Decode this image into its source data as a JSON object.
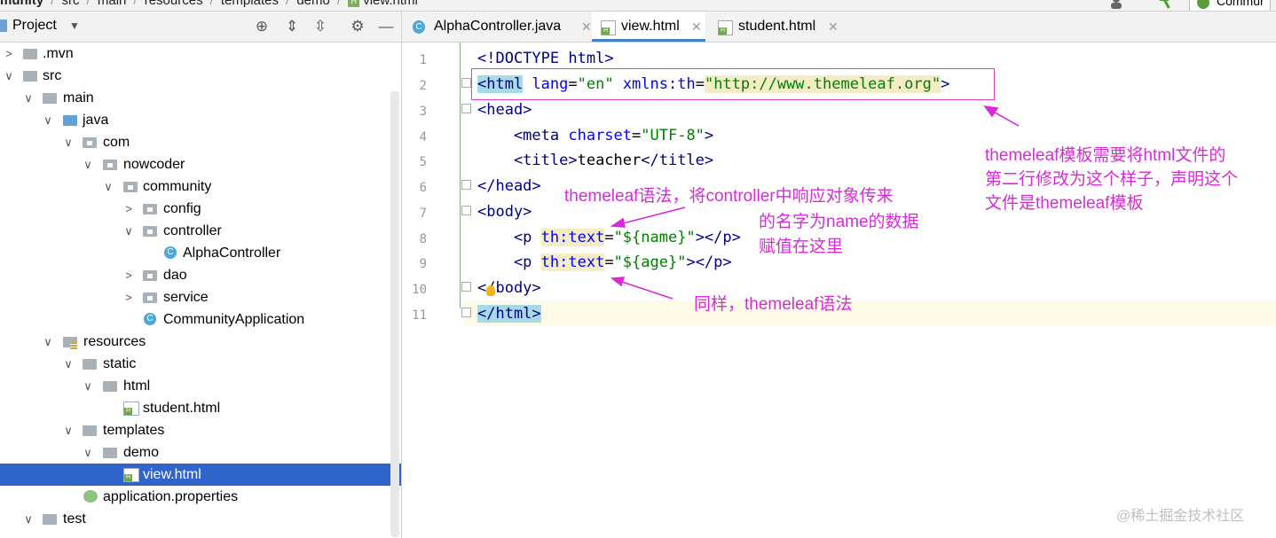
{
  "breadcrumb": {
    "items": [
      "munity",
      "src",
      "main",
      "resources",
      "templates",
      "demo",
      "view.html"
    ]
  },
  "toolbar": {
    "run_config_label": "Commur"
  },
  "project_panel": {
    "title": "Project",
    "tree": [
      {
        "label": ".mvn",
        "expanded": false,
        "icon": "folder-icon"
      },
      {
        "label": "src",
        "expanded": true,
        "icon": "folder-icon"
      },
      {
        "label": "main",
        "expanded": true,
        "icon": "folder-icon"
      },
      {
        "label": "java",
        "expanded": true,
        "icon": "source-folder-icon"
      },
      {
        "label": "com",
        "expanded": true,
        "icon": "package-icon"
      },
      {
        "label": "nowcoder",
        "expanded": true,
        "icon": "package-icon"
      },
      {
        "label": "community",
        "expanded": true,
        "icon": "package-icon"
      },
      {
        "label": "config",
        "expanded": false,
        "icon": "package-icon"
      },
      {
        "label": "controller",
        "expanded": true,
        "icon": "package-icon"
      },
      {
        "label": "AlphaController",
        "icon": "java-class-icon"
      },
      {
        "label": "dao",
        "expanded": false,
        "icon": "package-icon"
      },
      {
        "label": "service",
        "expanded": false,
        "icon": "package-icon"
      },
      {
        "label": "CommunityApplication",
        "icon": "spring-boot-class-icon"
      },
      {
        "label": "resources",
        "expanded": true,
        "icon": "resources-folder-icon"
      },
      {
        "label": "static",
        "expanded": true,
        "icon": "folder-icon"
      },
      {
        "label": "html",
        "expanded": true,
        "icon": "folder-icon"
      },
      {
        "label": "student.html",
        "icon": "html-file-icon"
      },
      {
        "label": "templates",
        "expanded": true,
        "icon": "folder-icon"
      },
      {
        "label": "demo",
        "expanded": true,
        "icon": "folder-icon"
      },
      {
        "label": "view.html",
        "icon": "html-file-icon",
        "selected": true
      },
      {
        "label": "application.properties",
        "icon": "properties-file-icon"
      },
      {
        "label": "test",
        "expanded": true,
        "icon": "folder-icon"
      }
    ]
  },
  "editor": {
    "tabs": [
      {
        "label": "AlphaController.java",
        "active": false
      },
      {
        "label": "view.html",
        "active": true
      },
      {
        "label": "student.html",
        "active": false
      }
    ],
    "line_numbers": [
      "1",
      "2",
      "3",
      "4",
      "5",
      "6",
      "7",
      "8",
      "9",
      "10",
      "11"
    ],
    "code": {
      "l1": {
        "t1": "<!DOCTYPE ",
        "t2": "html",
        "t3": ">"
      },
      "l2": {
        "t1": "<html",
        "t2": " lang",
        "t3": "=",
        "t4": "\"en\"",
        "t5": " xmlns:th",
        "t6": "=",
        "t7": "\"http://www.themeleaf.org\"",
        "t8": ">"
      },
      "l3": {
        "t1": "<head>"
      },
      "l4": {
        "t1": "    <meta",
        "t2": " charset",
        "t3": "=",
        "t4": "\"UTF-8\"",
        "t5": ">"
      },
      "l5": {
        "t1": "    <title>",
        "t2": "teacher",
        "t3": "</title>"
      },
      "l6": {
        "t1": "</head>"
      },
      "l7": {
        "t1": "<body>"
      },
      "l8": {
        "t1": "    <p ",
        "t2": "th:text",
        "t3": "=",
        "t4": "\"${name}\"",
        "t5": "></p>"
      },
      "l9": {
        "t1": "    <p ",
        "t2": "th:text",
        "t3": "=",
        "t4": "\"${age}\"",
        "t5": "></p>"
      },
      "l10": {
        "t1": "</body>"
      },
      "l11": {
        "t1": "</html>"
      }
    }
  },
  "annotations": {
    "doctype_note": [
      "themeleaf模板需要将html文件的",
      "第二行修改为这个样子，声明这个",
      "文件是themeleaf模板"
    ],
    "syntax_note": [
      "themeleaf语法，将controller中响应对象传来",
      "的名字为name的数据",
      "赋值在这里"
    ],
    "same_note": "同样，themeleaf语法",
    "color": "#d82ad8"
  },
  "watermark": "@稀土掘金技术社区"
}
